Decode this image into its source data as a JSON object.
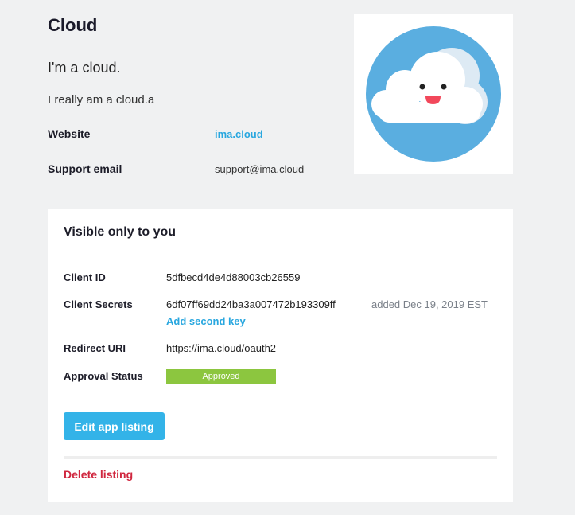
{
  "app": {
    "name": "Cloud",
    "tagline": "I'm a cloud.",
    "description": "I really am a cloud.a",
    "website_label": "Website",
    "website_value": "ima.cloud",
    "support_label": "Support email",
    "support_value": "support@ima.cloud",
    "logo_icon": "smiling-cloud-icon"
  },
  "private": {
    "title": "Visible only to you",
    "client_id_label": "Client ID",
    "client_id_value": "5dfbecd4de4d88003cb26559",
    "client_secrets_label": "Client Secrets",
    "client_secret_value": "6df07ff69dd24ba3a007472b193309ff",
    "client_secret_added": "added Dec 19, 2019 EST",
    "add_key_label": "Add second key",
    "redirect_label": "Redirect URI",
    "redirect_value": "https://ima.cloud/oauth2",
    "approval_label": "Approval Status",
    "approval_value": "Approved",
    "edit_button_label": "Edit app listing",
    "delete_label": "Delete listing"
  },
  "colors": {
    "page_bg": "#f0f1f2",
    "accent": "#29a7df",
    "button": "#33b3e8",
    "approved": "#8cc63f",
    "danger": "#d0273f",
    "logo_circle": "#5aaee0"
  }
}
